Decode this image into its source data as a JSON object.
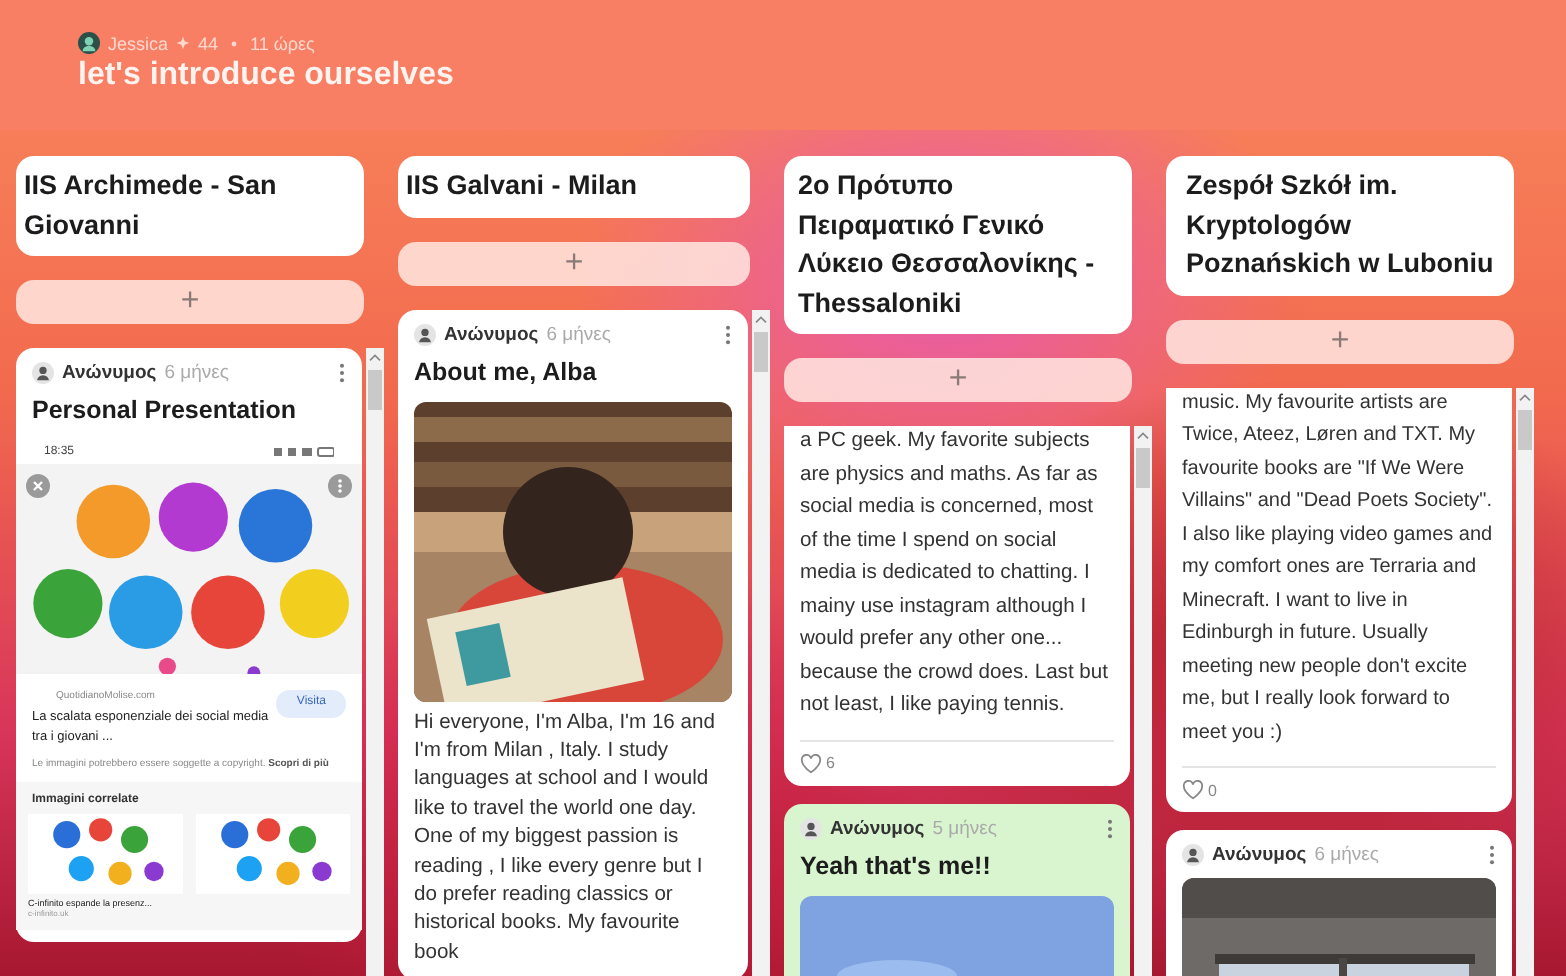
{
  "board": {
    "author": "Jessica",
    "likes": "44",
    "time": "11 ώρες",
    "title": "let's introduce ourselves"
  },
  "columns": [
    {
      "title": "IIS Archimede - San Giovanni",
      "add_label": "+",
      "posts": [
        {
          "color": "#ffffff",
          "author": "Ανώνυμος",
          "time": "6 μήνες",
          "title": "Personal Presentation",
          "attachment": {
            "kind": "phone_screenshot",
            "status_time": "18:35",
            "source": "QuotidianoMolise.com",
            "headline": "La scalata esponenziale dei social media tra i giovani ...",
            "visit_button": "Visita",
            "notice": "Le immagini potrebbero essere soggette a copyright.",
            "notice_link": "Scopri di più",
            "related_heading": "Immagini correlate",
            "related": [
              {
                "kind": "picture",
                "caption": "C-infinito espande la presenz...",
                "site": "c-infinito.uk"
              },
              {
                "kind": "picture"
              }
            ]
          }
        }
      ]
    },
    {
      "title": "IIS Galvani - Milan",
      "add_label": "+",
      "posts": [
        {
          "color": "#ffffff",
          "author": "Ανώνυμος",
          "time": "6 μήνες",
          "title": "About me, Alba",
          "attachment": {
            "kind": "picture"
          },
          "body": "Hi everyone, I'm Alba, I'm 16 and I'm from Milan , Italy. I study languages at school and I would like to travel the world one day. One of my biggest passion is reading , I like every genre but I do prefer reading classics or historical books. My favourite book"
        }
      ]
    },
    {
      "title": "2ο Πρότυπο Πειραματικό Γενικό Λύκειο Θεσσαλονίκης - Thessaloniki",
      "add_label": "+",
      "posts": [
        {
          "color": "#ffffff",
          "body": "a PC geek. My favorite subjects are physics and maths. As far as social media is concerned, most of the time I spend on social media is dedicated to chatting. I mainy use instagram although I would prefer any other one... because the crowd does. Last but not least, I like paying tennis.",
          "likes": "6"
        },
        {
          "color": "#d8f5cf",
          "author": "Ανώνυμος",
          "time": "5 μήνες",
          "title": "Yeah that's me!!",
          "attachment": {
            "kind": "picture"
          }
        }
      ]
    },
    {
      "title": "Zespół Szkół im. Kryptologów Poznańskich w Luboniu",
      "add_label": "+",
      "posts": [
        {
          "color": "#ffffff",
          "body": "music. My favourite artists are Twice, Ateez, Løren and TXT. My favourite books are \"If We Were Villains\" and \"Dead Poets Society\". I also like playing video games and my comfort ones are Terraria and Minecraft. I want to live in Edinburgh in future. Usually meeting new people don't excite me, but I really look forward to meet you :)",
          "likes": "0"
        },
        {
          "color": "#ffffff",
          "author": "Ανώνυμος",
          "time": "6 μήνες",
          "attachment": {
            "kind": "picture"
          }
        }
      ]
    }
  ]
}
